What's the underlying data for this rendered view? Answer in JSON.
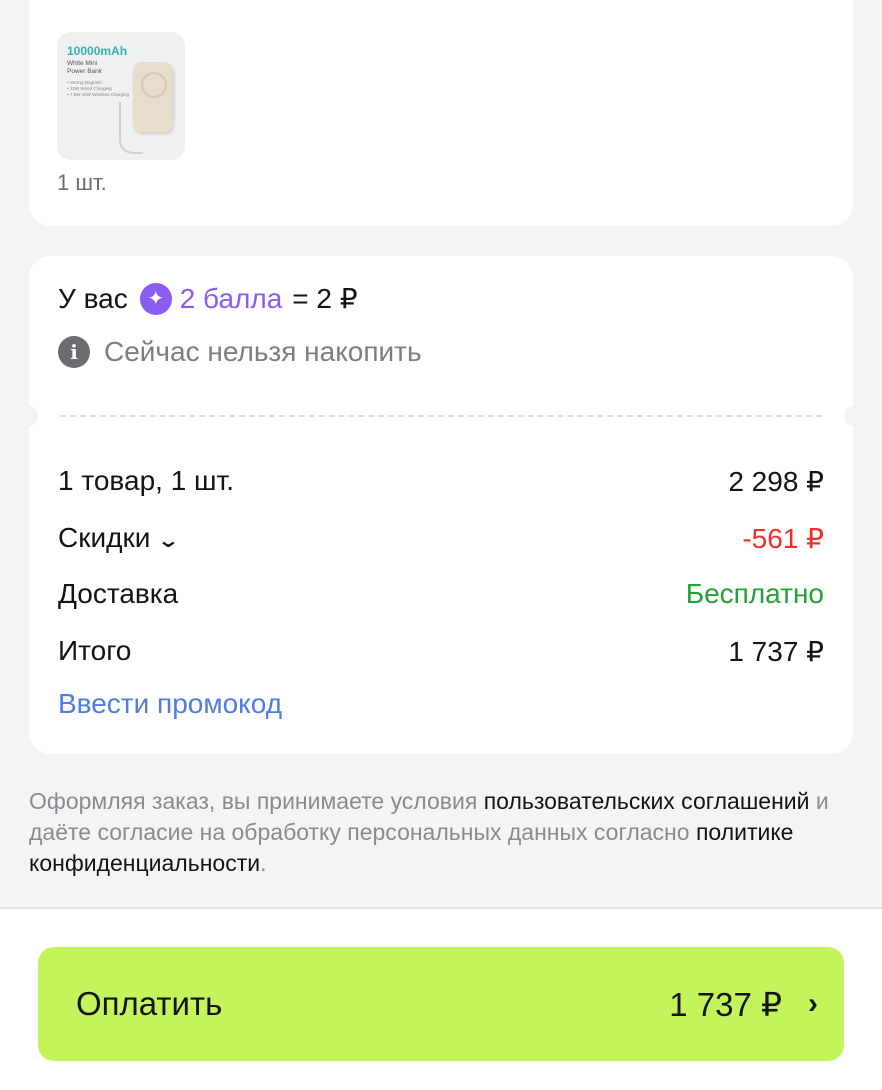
{
  "product": {
    "thumb_capacity": "10000mAh",
    "thumb_title_1": "White Mini",
    "thumb_title_2": "Power Bank",
    "thumb_bullet_1": "• Strong Magnetic",
    "thumb_bullet_2": "• 22W Wired Charging",
    "thumb_bullet_3": "• 7.5W-15W Wireless Charging",
    "quantity": "1 шт."
  },
  "points": {
    "prefix": "У вас",
    "icon": "sparkle-star-icon",
    "amount": "2 балла",
    "equals": "= 2 ₽",
    "info_icon": "info-icon",
    "info_text": "Сейчас нельзя накопить"
  },
  "summary": {
    "items_label": "1 товар, 1 шт.",
    "items_value": "2 298 ₽",
    "discounts_label": "Скидки",
    "discounts_value": "-561 ₽",
    "delivery_label": "Доставка",
    "delivery_value": "Бесплатно",
    "total_label": "Итого",
    "total_value": "1 737 ₽",
    "promo_link": "Ввести промокод"
  },
  "legal": {
    "part1": "Оформляя заказ, вы принимаете условия ",
    "link1": "пользовательских соглашений",
    "part2": " и даёте согласие на обработку персональных данных согласно ",
    "link2": "политике конфиденциальности",
    "part3": "."
  },
  "pay": {
    "label": "Оплатить",
    "amount": "1 737 ₽",
    "arrow": "›"
  },
  "colors": {
    "accent_green_button": "#c4f45b",
    "points_purple": "#8a5cf5",
    "discount_red": "#f0302e",
    "delivery_green": "#22a335",
    "link_blue": "#4f7de1"
  }
}
